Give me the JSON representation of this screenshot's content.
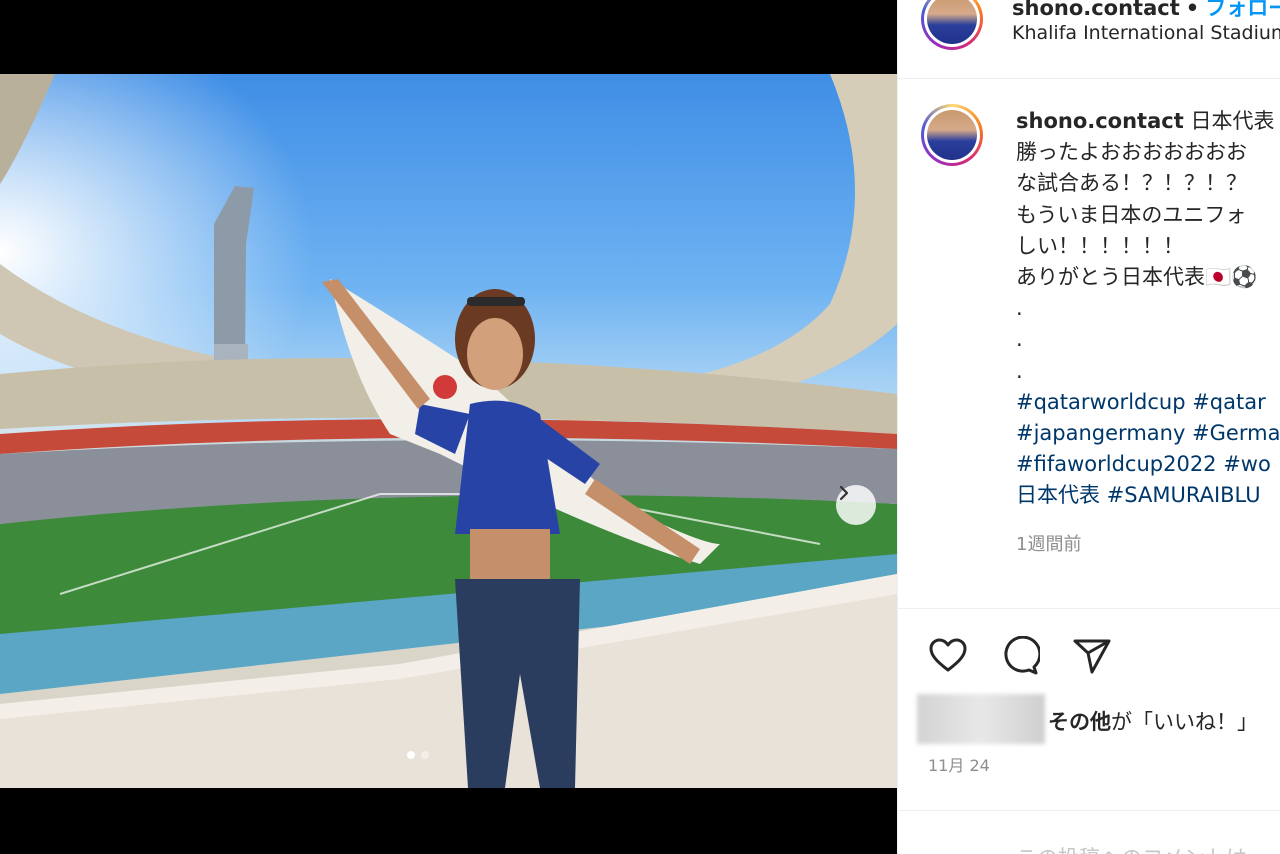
{
  "header": {
    "username": "shono.contact",
    "separator": "•",
    "follow_label": "フォロー",
    "location": "Khalifa International Stadium"
  },
  "caption": {
    "username": "shono.contact",
    "lines": [
      "日本代表",
      "勝ったよおおおおおおお",
      "な試合ある！？！？！？",
      "もういま日本のユニフォ",
      "しい！！！！！！",
      "ありがとう日本代表🇯🇵⚽",
      ".",
      ".",
      "."
    ],
    "hashtag_lines": [
      "#qatarworldcup #qatar",
      "#japangermany #Germa",
      "#fifaworldcup2022 #wo",
      "日本代表 #SAMURAIBLU"
    ],
    "time_ago": "1週間前"
  },
  "likes": {
    "others_label": "その他",
    "suffix": "が「いいね！」"
  },
  "post_date": "11月 24",
  "comment_placeholder": "この投稿へのコメントは",
  "carousel": {
    "current": 1,
    "total": 2
  },
  "colors": {
    "link": "#0095f6",
    "hashtag": "#00376b",
    "muted": "#8e8e8e"
  },
  "icons": [
    "heart-icon",
    "comment-icon",
    "share-icon",
    "chevron-right-icon"
  ]
}
